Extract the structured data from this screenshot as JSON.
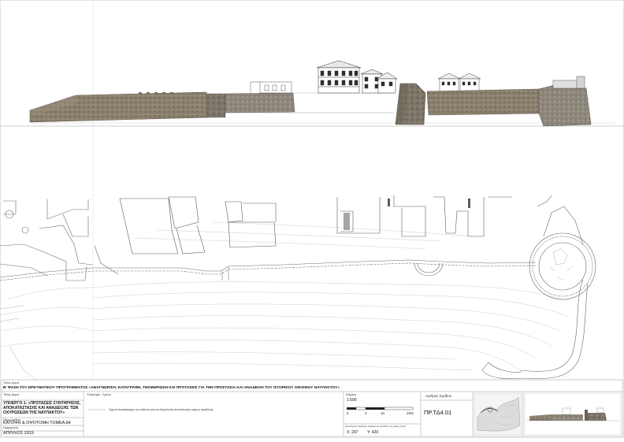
{
  "title_block": {
    "work_label": "Τίτλος έργου",
    "work_title": "Β' ΦΑΣΗ ΤΟΥ ΕΡΕΥΝΗΤΙΚΟΥ ΠΡΟΓΡΑΜΜΑΤΟΣ «ΑΝΑΓΝΩΡΙΣΗ, ΚΑΤΑΓΡΑΦΗ, ΤΕΚΜΗΡΙΩΣΗ ΚΑΙ ΠΡΟΤΑΣΕΙΣ ΓΙΑ ΤΗΝ ΠΡΟΣΤΑΣΙΑ ΚΑΙ ΑΝΑΔΕΙΞΗ ΤΟΥ ΙΣΤΟΡΙΚΟΥ ΟΙΚΙΣΜΟΥ ΝΑΥΠΑΚΤΟΥ»",
    "subproject_label": "Τίτλος έργου",
    "subproject_lines": [
      "ΥΠΟΕΡΓΟ 1: «ΠΡΟΤΑΣΕΙΣ ΣΥΝΤΗΡΗΣΗΣ,",
      "ΑΠΟΚΑΤΑΣΤΑΣΗΣ ΚΑΙ ΑΝΑΔΕΙΞΗΣ ΤΩΝ",
      "ΟΧΥΡΩΣΕΩΝ ΤΗΣ ΝΑΥΠΑΚΤΟΥ»"
    ],
    "drawing_label": "Θέμα σχεδίου",
    "drawing_title": "ΚΑΤΟΨΗ & ΟΨΟΤΟΜΗ ΤΟΜΕΑ Δ4",
    "date_label": "Ημερομηνία",
    "date": "ΑΠΡΙΛΙΟΣ 2019",
    "legend_label": "Υπόμνημα - Σχόλια",
    "legend_text": "Σημεία περιστροφής των αξόνων για την θεμελιώδη αποτύπωσης οψεως προβολής",
    "scale_label": "Κλίμακα",
    "scale": "1:500",
    "scale_ticks": [
      "0",
      "5",
      "10",
      "20M"
    ],
    "coords_label": "Διαστάσεις πλαισίου σχεδίου σε μονάδα του χάρτη (mm)",
    "coord_x": "X: 297",
    "coord_y": "Y: 420",
    "drawing_number_label": "Αριθμός Σχεδίου",
    "drawing_number": "ΠΡ.ΤΔ4.01"
  },
  "colors": {
    "masonry": "#857a6a",
    "masonry_light": "#a49a88",
    "line": "#555555",
    "plan_line": "#777777",
    "contour": "#c6c6c6"
  }
}
